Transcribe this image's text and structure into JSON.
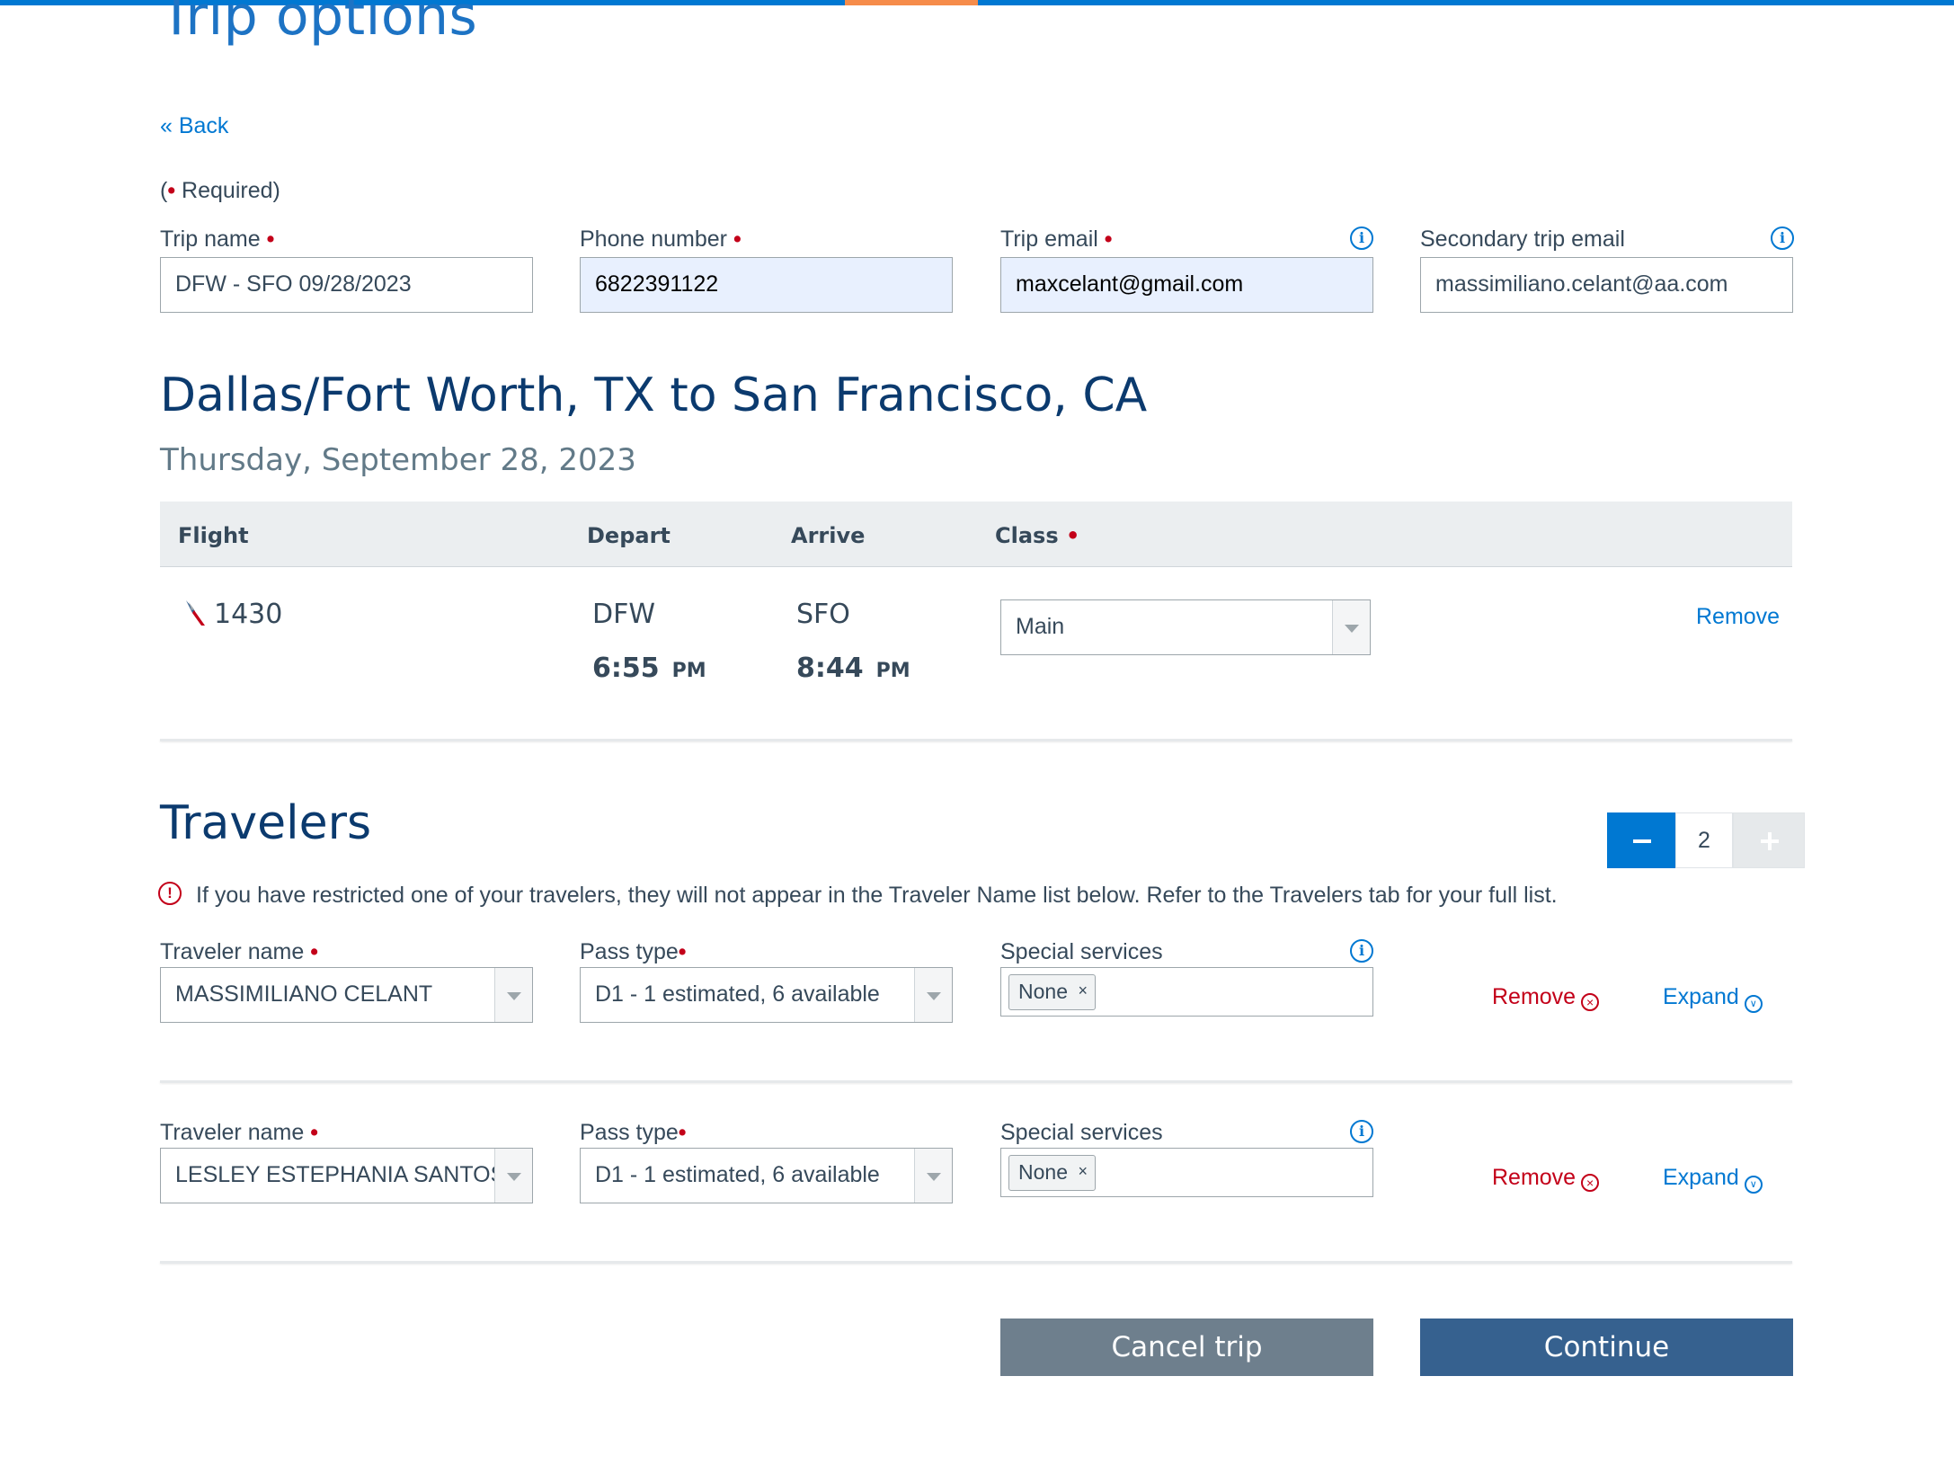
{
  "page": {
    "title": "Trip options",
    "back_label": "« Back",
    "required_note": "Required)",
    "required_open": "("
  },
  "colors": {
    "accent": "#0078d2",
    "heading": "#0b3a6e",
    "danger": "#c30019",
    "progress_segment": "#f68c4a"
  },
  "trip_fields": {
    "trip_name": {
      "label": "Trip name",
      "value": "DFW - SFO  09/28/2023"
    },
    "phone": {
      "label": "Phone number",
      "value": "6822391122"
    },
    "email": {
      "label": "Trip email",
      "value": "maxcelant@gmail.com"
    },
    "secondary_email": {
      "label": "Secondary trip email",
      "value": "massimiliano.celant@aa.com"
    }
  },
  "route": {
    "title": "Dallas/Fort Worth, TX to San Francisco, CA",
    "date": "Thursday, September 28, 2023"
  },
  "flight_table": {
    "headers": {
      "flight": "Flight",
      "depart": "Depart",
      "arrive": "Arrive",
      "class": "Class"
    },
    "row": {
      "flight_number": "1430",
      "depart_airport": "DFW",
      "depart_time": "6:55",
      "depart_ampm": "PM",
      "arrive_airport": "SFO",
      "arrive_time": "8:44",
      "arrive_ampm": "PM",
      "class_value": "Main",
      "remove_label": "Remove"
    }
  },
  "travelers": {
    "title": "Travelers",
    "count": "2",
    "notice": "If you have restricted one of your travelers, they will not appear in the Traveler Name list below. Refer to the Travelers tab for your full list.",
    "labels": {
      "name": "Traveler name",
      "pass": "Pass type",
      "services": "Special services",
      "remove": "Remove",
      "expand": "Expand"
    },
    "list": [
      {
        "name": "MASSIMILIANO CELANT",
        "pass_type": "D1 - 1 estimated, 6 available",
        "service_tag": "None"
      },
      {
        "name": "LESLEY ESTEPHANIA SANTOS",
        "pass_type": "D1 - 1 estimated, 6 available",
        "service_tag": "None"
      }
    ]
  },
  "actions": {
    "cancel": "Cancel trip",
    "continue": "Continue"
  }
}
